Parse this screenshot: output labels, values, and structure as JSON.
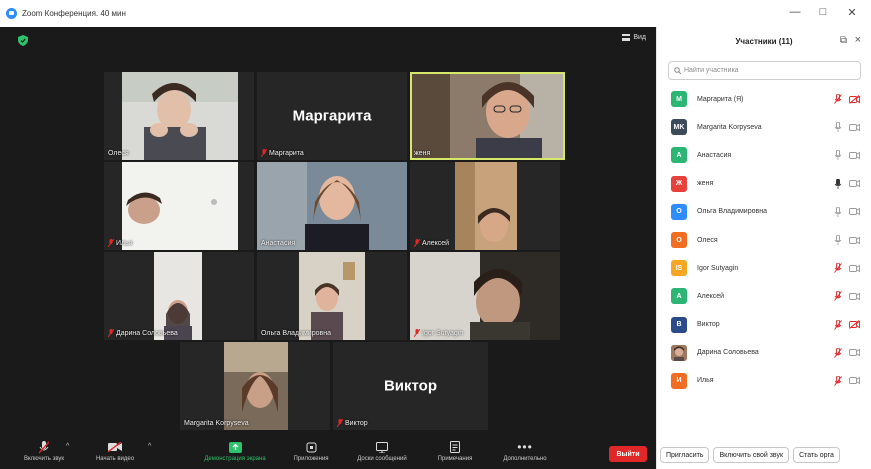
{
  "window": {
    "title": "Zoom Конференция. 40 мин",
    "controls": [
      "—",
      "□",
      "✕"
    ]
  },
  "stage": {
    "view_label": "Вид"
  },
  "tiles": [
    {
      "id": "olesya",
      "name": "Олеся",
      "muted": false,
      "video": true,
      "active": false,
      "big_name": ""
    },
    {
      "id": "margarita",
      "name": "Маргарита",
      "muted": true,
      "video": false,
      "active": false,
      "big_name": "Маргарита"
    },
    {
      "id": "zhenya",
      "name": "женя",
      "muted": false,
      "video": true,
      "active": true,
      "big_name": ""
    },
    {
      "id": "ilya",
      "name": "Илья",
      "muted": true,
      "video": true,
      "active": false,
      "big_name": ""
    },
    {
      "id": "anastasia",
      "name": "Анастасия",
      "muted": false,
      "video": true,
      "active": false,
      "big_name": ""
    },
    {
      "id": "aleksey",
      "name": "Алексей",
      "muted": true,
      "video": true,
      "active": false,
      "big_name": ""
    },
    {
      "id": "darina",
      "name": "Дарина Соловьева",
      "muted": true,
      "video": true,
      "active": false,
      "big_name": ""
    },
    {
      "id": "olga",
      "name": "Ольга Владимировна",
      "muted": false,
      "video": true,
      "active": false,
      "big_name": ""
    },
    {
      "id": "igor",
      "name": "Igor Sutyagin",
      "muted": true,
      "video": true,
      "active": false,
      "big_name": ""
    },
    {
      "id": "margarita_k",
      "name": "Margarita Korpyseva",
      "muted": false,
      "video": true,
      "active": false,
      "big_name": ""
    },
    {
      "id": "viktor",
      "name": "Виктор",
      "muted": true,
      "video": false,
      "active": false,
      "big_name": "Виктор"
    }
  ],
  "toolbar": {
    "unmute": "Включить звук",
    "start_video": "Начать видео",
    "share_screen": "Демонстрация экрана",
    "apps": "Приложения",
    "whiteboards": "Доски сообщений",
    "notes": "Примечания",
    "more": "Дополнительно",
    "leave": "Выйти"
  },
  "panel": {
    "title": "Участники (11)",
    "search_placeholder": "Найти участника",
    "invite": "Пригласить",
    "unmute_me": "Включить свой звук",
    "become_host": "Стать орга"
  },
  "participants": [
    {
      "initials": "М",
      "color": "#2bb673",
      "name": "Маргарита (Я)",
      "mic_muted": true,
      "cam_off": true,
      "photo": false
    },
    {
      "initials": "MK",
      "color": "#3d4a5c",
      "name": "Margarita Korpyseva",
      "mic_muted": false,
      "cam_off": false,
      "photo": false
    },
    {
      "initials": "А",
      "color": "#2bb673",
      "name": "Анастасия",
      "mic_muted": false,
      "cam_off": false,
      "photo": false
    },
    {
      "initials": "Ж",
      "color": "#e8413c",
      "name": "женя",
      "mic_muted": false,
      "mic_active": true,
      "cam_off": false,
      "photo": false
    },
    {
      "initials": "О",
      "color": "#2d8cff",
      "name": "Ольга Владимировна",
      "mic_muted": false,
      "cam_off": false,
      "photo": false
    },
    {
      "initials": "О",
      "color": "#f26d21",
      "name": "Олеся",
      "mic_muted": false,
      "cam_off": false,
      "photo": false
    },
    {
      "initials": "IS",
      "color": "#f5a623",
      "name": "Igor Sutyagin",
      "mic_muted": true,
      "cam_off": false,
      "photo": false
    },
    {
      "initials": "А",
      "color": "#2bb673",
      "name": "Алексей",
      "mic_muted": true,
      "cam_off": false,
      "photo": false
    },
    {
      "initials": "В",
      "color": "#2a4a8a",
      "name": "Виктор",
      "mic_muted": true,
      "cam_off": true,
      "photo": false
    },
    {
      "initials": "",
      "color": "#7a5a48",
      "name": "Дарина Соловьева",
      "mic_muted": true,
      "cam_off": false,
      "photo": true
    },
    {
      "initials": "И",
      "color": "#f26d21",
      "name": "Илья",
      "mic_muted": true,
      "cam_off": false,
      "photo": false
    }
  ]
}
